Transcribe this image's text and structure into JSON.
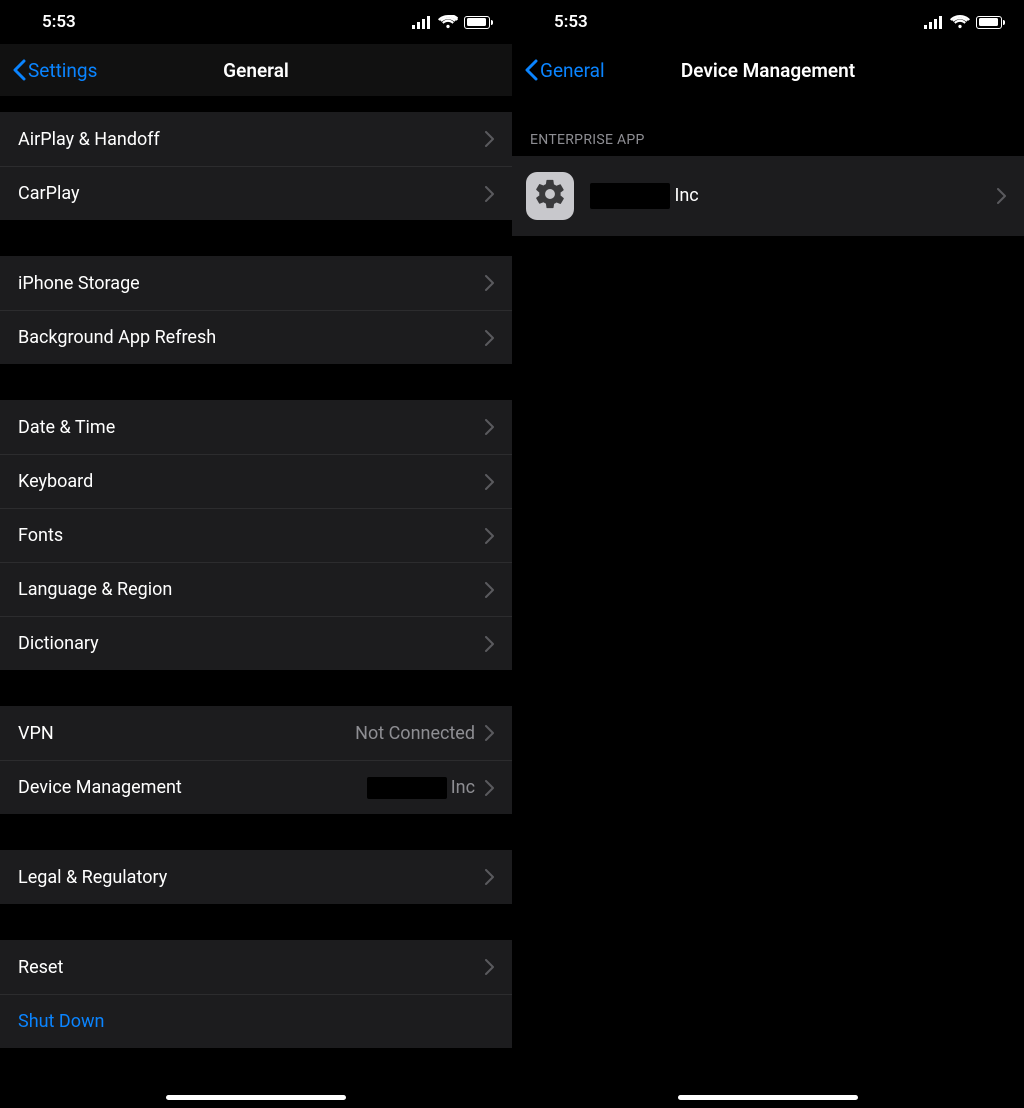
{
  "left": {
    "status": {
      "time": "5:53"
    },
    "nav": {
      "back": "Settings",
      "title": "General"
    },
    "groups": [
      {
        "rows": [
          {
            "label": "AirPlay & Handoff"
          },
          {
            "label": "CarPlay"
          }
        ]
      },
      {
        "rows": [
          {
            "label": "iPhone Storage"
          },
          {
            "label": "Background App Refresh"
          }
        ]
      },
      {
        "rows": [
          {
            "label": "Date & Time"
          },
          {
            "label": "Keyboard"
          },
          {
            "label": "Fonts"
          },
          {
            "label": "Language & Region"
          },
          {
            "label": "Dictionary"
          }
        ]
      },
      {
        "rows": [
          {
            "label": "VPN",
            "detail": "Not Connected"
          },
          {
            "label": "Device Management",
            "detail_redacted": true,
            "detail_suffix": "Inc"
          }
        ]
      },
      {
        "rows": [
          {
            "label": "Legal & Regulatory"
          }
        ]
      },
      {
        "rows": [
          {
            "label": "Reset"
          },
          {
            "label": "Shut Down",
            "link": true,
            "noarrow": true
          }
        ]
      }
    ]
  },
  "right": {
    "status": {
      "time": "5:53"
    },
    "nav": {
      "back": "General",
      "title": "Device Management"
    },
    "section_header": "ENTERPRISE APP",
    "profile": {
      "label_redacted": true,
      "label_suffix": "Inc"
    }
  }
}
